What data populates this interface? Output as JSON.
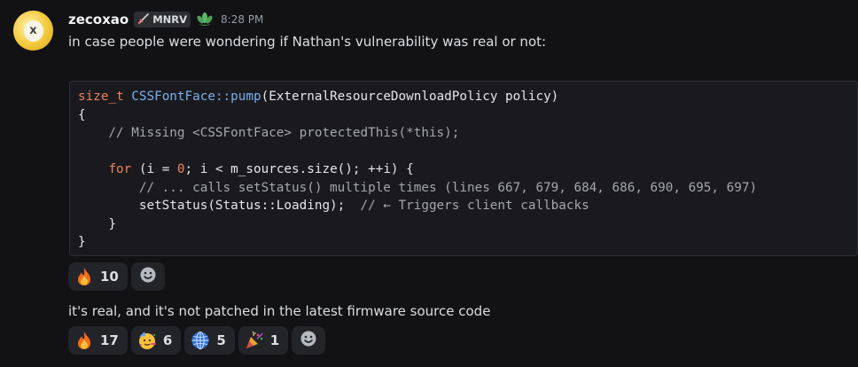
{
  "author": {
    "username": "zecoxao",
    "avatar_letter": "x",
    "tag_label": "MNRV",
    "tag_icon": "sword-icon",
    "role_icon": "green-lotus-icon",
    "timestamp": "8:28 PM"
  },
  "message1": {
    "text": "in case people were wondering if Nathan's vulnerability was real or not:"
  },
  "code": {
    "lines": [
      "size_t CSSFontFace::pump(ExternalResourceDownloadPolicy policy)",
      "{",
      "    // Missing <CSSFontFace> protectedThis(*this);",
      "",
      "    for (i = 0; i < m_sources.size(); ++i) {",
      "        // ... calls setStatus() multiple times (lines 667, 679, 684, 686, 690, 695, 697)",
      "        setStatus(Status::Loading);  // ← Triggers client callbacks",
      "    }",
      "}"
    ]
  },
  "reactions1": [
    {
      "emoji": "fire-emoji",
      "count": "10"
    }
  ],
  "message2": {
    "text": "it's real, and it's not patched in the latest firmware source code"
  },
  "reactions2": [
    {
      "emoji": "fire-emoji",
      "count": "17"
    },
    {
      "emoji": "partying-face-emoji",
      "count": "6"
    },
    {
      "emoji": "globe-emoji",
      "count": "5"
    },
    {
      "emoji": "party-popper-emoji",
      "count": "1"
    }
  ],
  "add_reaction_icon": "add-reaction-smiley-icon",
  "colors": {
    "background": "#121214",
    "code_background": "#1a1a1e",
    "keyword": "#e8845a",
    "function": "#7aaeee",
    "comment": "#a4a6ad",
    "text": "#dbdee1",
    "timestamp": "#949ba4"
  }
}
